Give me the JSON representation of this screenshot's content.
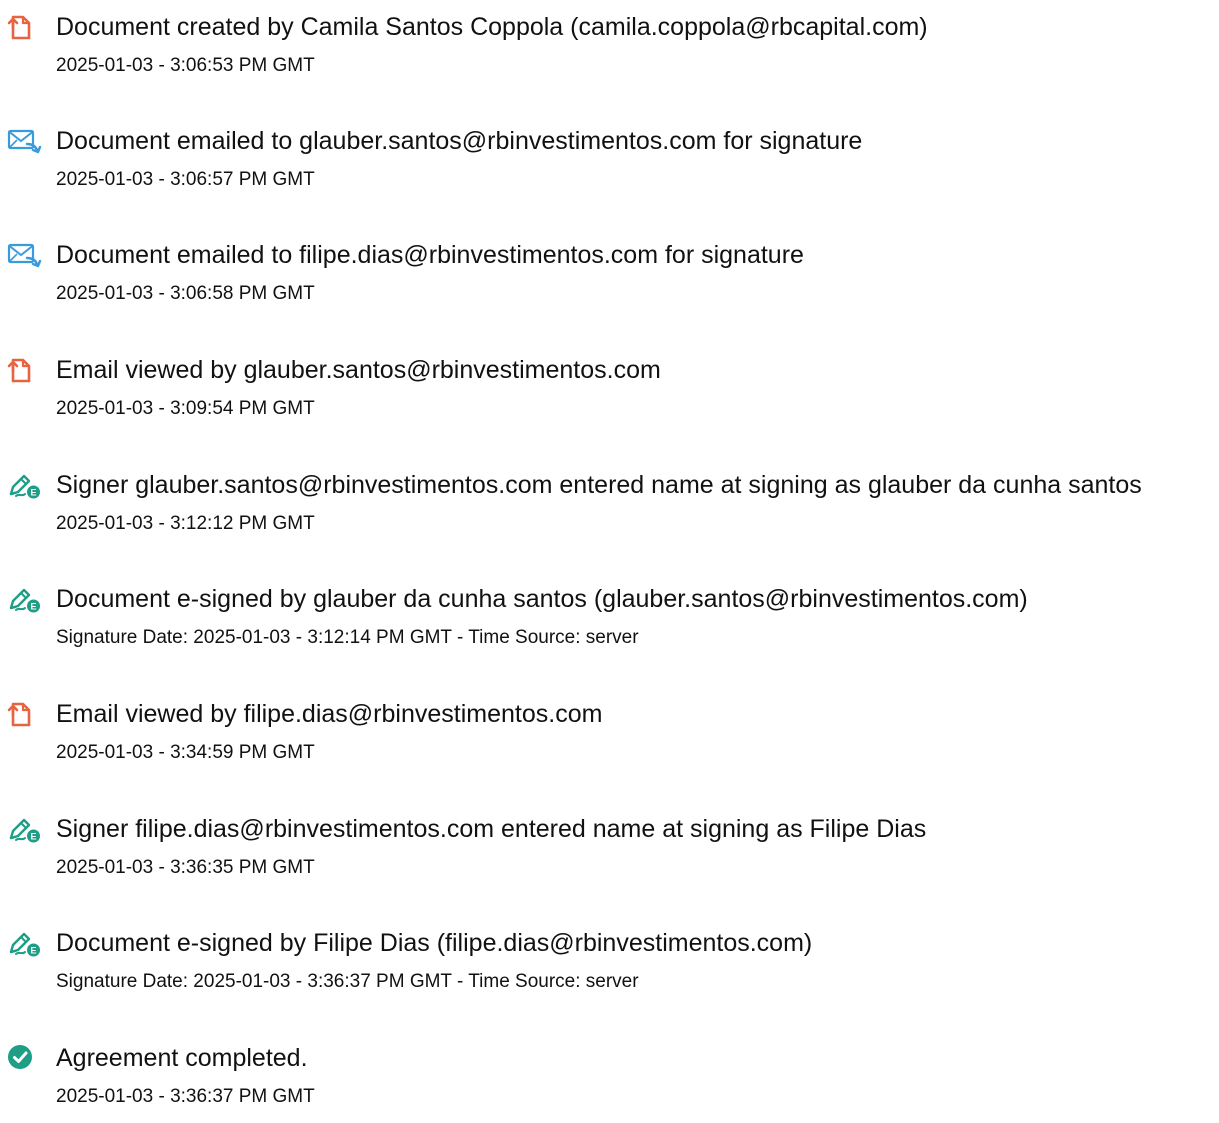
{
  "colors": {
    "document_icon": "#E8633F",
    "email_icon": "#3A9BDC",
    "esign_icon": "#1E9E86",
    "complete_icon": "#1E9E86",
    "text": "#111111"
  },
  "events": [
    {
      "icon": "document-icon",
      "title": "Document created by Camila Santos Coppola (camila.coppola@rbcapital.com)",
      "detail": "2025-01-03 - 3:06:53 PM GMT"
    },
    {
      "icon": "email-sent-icon",
      "title": "Document emailed to glauber.santos@rbinvestimentos.com for signature",
      "detail": "2025-01-03 - 3:06:57 PM GMT"
    },
    {
      "icon": "email-sent-icon",
      "title": "Document emailed to filipe.dias@rbinvestimentos.com for signature",
      "detail": "2025-01-03 - 3:06:58 PM GMT"
    },
    {
      "icon": "document-icon",
      "title": "Email viewed by glauber.santos@rbinvestimentos.com",
      "detail": "2025-01-03 - 3:09:54 PM GMT"
    },
    {
      "icon": "esign-pen-icon",
      "title": "Signer glauber.santos@rbinvestimentos.com entered name at signing as glauber da cunha santos",
      "detail": "2025-01-03 - 3:12:12 PM GMT"
    },
    {
      "icon": "esign-pen-icon",
      "title": "Document e-signed by glauber da cunha santos (glauber.santos@rbinvestimentos.com)",
      "detail": "Signature Date: 2025-01-03 - 3:12:14 PM GMT - Time Source: server"
    },
    {
      "icon": "document-icon",
      "title": "Email viewed by filipe.dias@rbinvestimentos.com",
      "detail": "2025-01-03 - 3:34:59 PM GMT"
    },
    {
      "icon": "esign-pen-icon",
      "title": "Signer filipe.dias@rbinvestimentos.com entered name at signing as Filipe Dias",
      "detail": "2025-01-03 - 3:36:35 PM GMT"
    },
    {
      "icon": "esign-pen-icon",
      "title": "Document e-signed by Filipe Dias (filipe.dias@rbinvestimentos.com)",
      "detail": "Signature Date: 2025-01-03 - 3:36:37 PM GMT - Time Source: server"
    },
    {
      "icon": "check-circle-icon",
      "title": "Agreement completed.",
      "detail": "2025-01-03 - 3:36:37 PM GMT"
    }
  ]
}
